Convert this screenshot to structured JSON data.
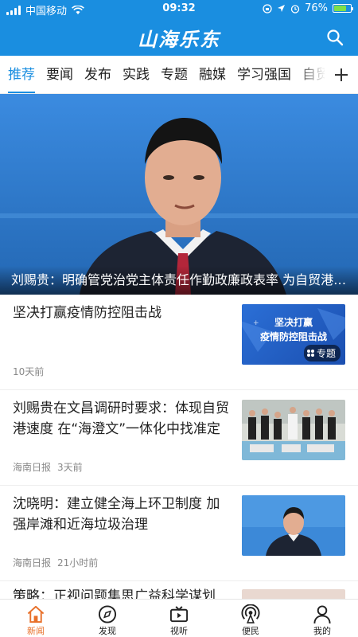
{
  "status": {
    "carrier": "中国移动",
    "time": "09:32",
    "battery": "76%",
    "battery_level": 0.76
  },
  "header": {
    "title": "山海乐东"
  },
  "tabs": [
    "推荐",
    "要闻",
    "发布",
    "实践",
    "专题",
    "融媒",
    "学习强国",
    "自贸"
  ],
  "hero": {
    "caption": "刘赐贵：明确管党治党主体责任作勤政廉政表率 为自贸港建设提供坚强保证"
  },
  "news": [
    {
      "title": "坚决打赢疫情防控阻击战",
      "source": "",
      "time": "10天前",
      "thumb_title": "坚决打赢\n疫情防控阻击战",
      "thumb_tag": "专题"
    },
    {
      "title": "刘赐贵在文昌调研时要求：体现自贸港速度 在“海澄文”一体化中找准定位",
      "source": "海南日报",
      "time": "3天前"
    },
    {
      "title": "沈晓明：建立健全海上环卫制度 加强岸滩和近海垃圾治理",
      "source": "海南日报",
      "time": "21小时前"
    },
    {
      "title": "策略：正视问题集思广益科学谋划",
      "source": "",
      "time": ""
    }
  ],
  "bottom_nav": [
    "新闻",
    "发现",
    "视听",
    "便民",
    "我的"
  ],
  "colors": {
    "primary": "#1a8ee0",
    "active_nav": "#e8702a"
  }
}
